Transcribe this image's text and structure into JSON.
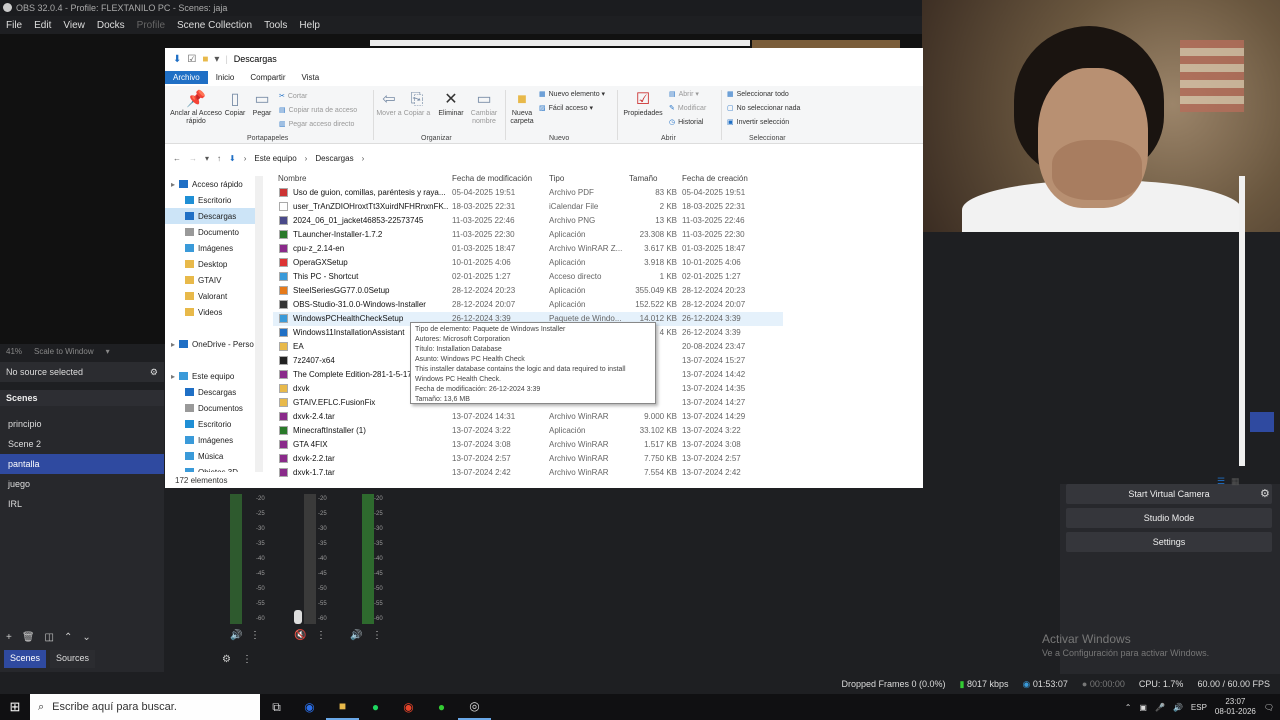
{
  "obs": {
    "title": "OBS 32.0.4 - Profile: FLEXTANILO PC - Scenes: jaja",
    "menu": [
      "File",
      "Edit",
      "View",
      "Docks",
      "Profile",
      "Scene Collection",
      "Tools",
      "Help"
    ],
    "zoom": "41%",
    "zoom_mode": "Scale to Window",
    "no_source": "No source selected",
    "scenes_header": "Scenes",
    "scenes": [
      "principio",
      "Scene 2",
      "pantalla",
      "juego",
      "IRL"
    ],
    "selected_scene": "pantalla",
    "dock_tabs": [
      "Scenes",
      "Sources"
    ],
    "controls": [
      "Start Virtual Camera",
      "Studio Mode",
      "Settings"
    ],
    "meter_labels": [
      "-20",
      "-25",
      "-30",
      "-35",
      "-40",
      "-45",
      "-50",
      "-55",
      "-60"
    ],
    "status": {
      "dropped": "Dropped Frames 0 (0.0%)",
      "kbps": "8017 kbps",
      "stream_time": "01:53:07",
      "rec_time": "00:00:00",
      "cpu": "CPU: 1.7%",
      "fps": "60.00 / 60.00 FPS"
    },
    "activate_title": "Activar Windows",
    "activate_sub": "Ve a Configuración para activar Windows."
  },
  "explorer": {
    "title": "Descargas",
    "tabs": [
      "Archivo",
      "Inicio",
      "Compartir",
      "Vista"
    ],
    "ribbon": {
      "pin": "Anclar al Acceso rápido",
      "copy": "Copiar",
      "paste": "Pegar",
      "cut": "Cortar",
      "copy_path": "Copiar ruta de acceso",
      "paste_shortcut": "Pegar acceso directo",
      "group_clipboard": "Portapapeles",
      "move_to": "Mover a",
      "copy_to": "Copiar a",
      "delete": "Eliminar",
      "rename": "Cambiar nombre",
      "group_organize": "Organizar",
      "new_folder": "Nueva carpeta",
      "new_item": "Nuevo elemento",
      "easy_access": "Fácil acceso",
      "group_new": "Nuevo",
      "properties": "Propiedades",
      "open": "Abrir",
      "modify": "Modificar",
      "history": "Historial",
      "group_open": "Abrir",
      "select_all": "Seleccionar todo",
      "select_none": "No seleccionar nada",
      "invert": "Invertir selección",
      "group_select": "Seleccionar"
    },
    "breadcrumb": [
      "Este equipo",
      "Descargas"
    ],
    "nav": [
      {
        "label": "Acceso rápido",
        "level": 0,
        "color": "#1f6fc5"
      },
      {
        "label": "Escritorio",
        "level": 1,
        "color": "#1f8fd5"
      },
      {
        "label": "Descargas",
        "level": 1,
        "color": "#1f6fc5",
        "selected": true
      },
      {
        "label": "Documento",
        "level": 1,
        "color": "#999"
      },
      {
        "label": "Imágenes",
        "level": 1,
        "color": "#3a9ad9"
      },
      {
        "label": "Desktop",
        "level": 1,
        "color": "#e8b94a"
      },
      {
        "label": "GTAIV",
        "level": 1,
        "color": "#e8b94a"
      },
      {
        "label": "Valorant",
        "level": 1,
        "color": "#e8b94a"
      },
      {
        "label": "Videos",
        "level": 1,
        "color": "#e8b94a"
      },
      {
        "label": "",
        "level": 1,
        "color": "#fff"
      },
      {
        "label": "OneDrive - Perso",
        "level": 0,
        "color": "#1f6fc5"
      },
      {
        "label": "",
        "level": 1,
        "color": "#fff"
      },
      {
        "label": "Este equipo",
        "level": 0,
        "color": "#3a9ad9"
      },
      {
        "label": "Descargas",
        "level": 1,
        "color": "#1f6fc5"
      },
      {
        "label": "Documentos",
        "level": 1,
        "color": "#999"
      },
      {
        "label": "Escritorio",
        "level": 1,
        "color": "#1f8fd5"
      },
      {
        "label": "Imágenes",
        "level": 1,
        "color": "#3a9ad9"
      },
      {
        "label": "Música",
        "level": 1,
        "color": "#3a9ad9"
      },
      {
        "label": "Objetos 3D",
        "level": 1,
        "color": "#3a9ad9"
      },
      {
        "label": "Videos",
        "level": 1,
        "color": "#7a5cc9"
      }
    ],
    "columns": [
      "Nombre",
      "Fecha de modificación",
      "Tipo",
      "Tamaño",
      "Fecha de creación"
    ],
    "files": [
      {
        "name": "Uso de guion, comillas, paréntesis y raya...",
        "date": "05-04-2025 19:51",
        "type": "Archivo PDF",
        "size": "83 KB",
        "created": "05-04-2025 19:51",
        "color": "#c33"
      },
      {
        "name": "user_TrAnZDIOHroxtTt3XuirdNFHRnxnFK...",
        "date": "18-03-2025 22:31",
        "type": "iCalendar File",
        "size": "2 KB",
        "created": "18-03-2025 22:31",
        "color": "#fff"
      },
      {
        "name": "2024_06_01_jacket46853-22573745",
        "date": "11-03-2025 22:46",
        "type": "Archivo PNG",
        "size": "13 KB",
        "created": "11-03-2025 22:46",
        "color": "#4a4a8a"
      },
      {
        "name": "TLauncher-Installer-1.7.2",
        "date": "11-03-2025 22:30",
        "type": "Aplicación",
        "size": "23.308 KB",
        "created": "11-03-2025 22:30",
        "color": "#2a7a2a"
      },
      {
        "name": "cpu-z_2.14-en",
        "date": "01-03-2025 18:47",
        "type": "Archivo WinRAR Z...",
        "size": "3.617 KB",
        "created": "01-03-2025 18:47",
        "color": "#8a2a8a"
      },
      {
        "name": "OperaGXSetup",
        "date": "10-01-2025 4:06",
        "type": "Aplicación",
        "size": "3.918 KB",
        "created": "10-01-2025 4:06",
        "color": "#d33"
      },
      {
        "name": "This PC - Shortcut",
        "date": "02-01-2025 1:27",
        "type": "Acceso directo",
        "size": "1 KB",
        "created": "02-01-2025 1:27",
        "color": "#3a9ad9"
      },
      {
        "name": "SteelSeriesGG77.0.0Setup",
        "date": "28-12-2024 20:23",
        "type": "Aplicación",
        "size": "355.049 KB",
        "created": "28-12-2024 20:23",
        "color": "#e67a1a"
      },
      {
        "name": "OBS-Studio-31.0.0-Windows-Installer",
        "date": "28-12-2024 20:07",
        "type": "Aplicación",
        "size": "152.522 KB",
        "created": "28-12-2024 20:07",
        "color": "#333"
      },
      {
        "name": "WindowsPCHealthCheckSetup",
        "date": "26-12-2024 3:39",
        "type": "Paquete de Windo...",
        "size": "14.012 KB",
        "created": "26-12-2024 3:39",
        "color": "#3a9ad9",
        "selected": true
      },
      {
        "name": "Windows11InstallationAssistant",
        "date": "26-12-2024 3:39",
        "type": "",
        "size": "4 KB",
        "created": "26-12-2024 3:39",
        "color": "#1f6fc5"
      },
      {
        "name": "EA",
        "date": "",
        "type": "",
        "size": "",
        "created": "20-08-2024 23:47",
        "color": "#e8b94a"
      },
      {
        "name": "7z2407-x64",
        "date": "",
        "type": "",
        "size": "",
        "created": "13-07-2024 15:27",
        "color": "#222"
      },
      {
        "name": "The Complete Edition-281-1-5-17",
        "date": "",
        "type": "",
        "size": "",
        "created": "13-07-2024 14:42",
        "color": "#8a2a8a"
      },
      {
        "name": "dxvk",
        "date": "",
        "type": "",
        "size": "",
        "created": "13-07-2024 14:35",
        "color": "#e8b94a"
      },
      {
        "name": "GTAIV.EFLC.FusionFix",
        "date": "",
        "type": "",
        "size": "",
        "created": "13-07-2024 14:27",
        "color": "#e8b94a"
      },
      {
        "name": "dxvk-2.4.tar",
        "date": "13-07-2024 14:31",
        "type": "Archivo WinRAR",
        "size": "9.000 KB",
        "created": "13-07-2024 14:29",
        "color": "#8a2a8a"
      },
      {
        "name": "MinecraftInstaller (1)",
        "date": "13-07-2024 3:22",
        "type": "Aplicación",
        "size": "33.102 KB",
        "created": "13-07-2024 3:22",
        "color": "#2a7a2a"
      },
      {
        "name": "GTA 4FIX",
        "date": "13-07-2024 3:08",
        "type": "Archivo WinRAR",
        "size": "1.517 KB",
        "created": "13-07-2024 3:08",
        "color": "#8a2a8a"
      },
      {
        "name": "dxvk-2.2.tar",
        "date": "13-07-2024 2:57",
        "type": "Archivo WinRAR",
        "size": "7.750 KB",
        "created": "13-07-2024 2:57",
        "color": "#8a2a8a"
      },
      {
        "name": "dxvk-1.7.tar",
        "date": "13-07-2024 2:42",
        "type": "Archivo WinRAR",
        "size": "7.554 KB",
        "created": "13-07-2024 2:42",
        "color": "#8a2a8a"
      }
    ],
    "item_count": "172 elementos",
    "tooltip": [
      "Tipo de elemento: Paquete de Windows Installer",
      "Autores: Microsoft Corporation",
      "Título: Installation Database",
      "Asunto: Windows PC Health Check",
      "This installer database contains the logic and data required to install",
      "Windows PC Health Check.",
      "Fecha de modificación: 26-12-2024 3:39",
      "Tamaño: 13,6 MB"
    ]
  },
  "taskbar": {
    "search_placeholder": "Escribe aquí para buscar.",
    "lang": "ESP",
    "time": "23:07",
    "date": "08-01-2026"
  }
}
